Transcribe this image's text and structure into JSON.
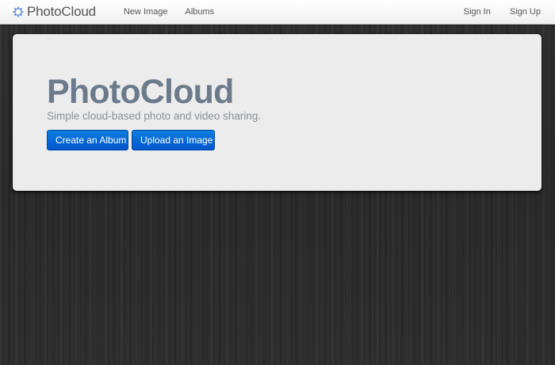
{
  "navbar": {
    "brand_name": "PhotoCloud",
    "brand_icon": "cloud-gear-icon",
    "left_links": [
      {
        "label": "New Image"
      },
      {
        "label": "Albums"
      }
    ],
    "right_links": [
      {
        "label": "Sign In"
      },
      {
        "label": "Sign Up"
      }
    ]
  },
  "hero": {
    "title": "PhotoCloud",
    "subtitle": "Simple cloud-based photo and video sharing.",
    "buttons": [
      {
        "label": "Create an Album"
      },
      {
        "label": "Upload an Image"
      }
    ]
  },
  "colors": {
    "accent": "#0066dd",
    "title": "#6c7b8c",
    "hero_bg": "#ececec",
    "page_bg": "#2b2b2b"
  }
}
